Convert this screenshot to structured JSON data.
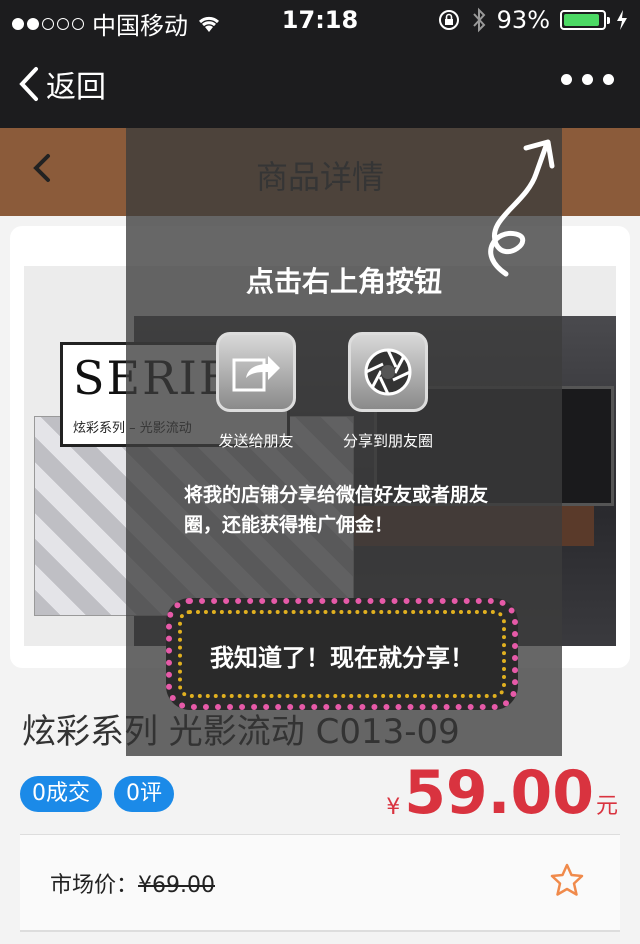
{
  "status_bar": {
    "carrier": "中国移动",
    "time": "17:18",
    "battery": "93%",
    "battery_level": 0.93
  },
  "nav": {
    "back_label": "返回",
    "more_icon": "more-dots-icon"
  },
  "header": {
    "title": "商品详情"
  },
  "product_image": {
    "brand": "SERIES",
    "subtitle": "炫彩系列 – 光影流动"
  },
  "overlay": {
    "title": "点击右上角按钮",
    "send_friend_label": "发送给朋友",
    "share_moments_label": "分享到朋友圈",
    "description": "将我的店铺分享给微信好友或者朋友圈，还能获得推广佣金！",
    "confirm_label": "我知道了！现在就分享！"
  },
  "product": {
    "title": "炫彩系列 光影流动 C013-09",
    "deals_badge": "0成交",
    "reviews_badge": "0评",
    "currency": "¥",
    "price": "59.00",
    "price_unit": "元",
    "market_label": "市场价：",
    "market_price": "¥69.00"
  },
  "colors": {
    "accent_red": "#d9333f",
    "badge_blue": "#1b8ae8",
    "header_brown": "#8b5b3a",
    "star_orange": "#f08a4b"
  }
}
